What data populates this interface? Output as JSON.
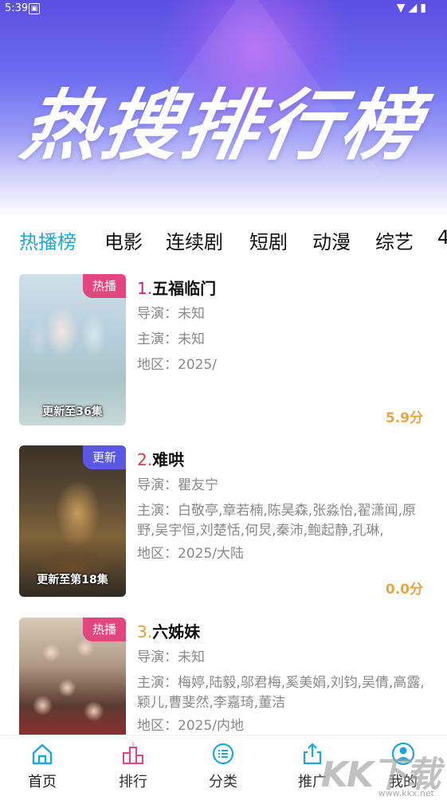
{
  "status": {
    "time": "5:39"
  },
  "hero": {
    "title": "热搜排行榜"
  },
  "tabs": [
    {
      "label": "热播榜",
      "active": true
    },
    {
      "label": "电影"
    },
    {
      "label": "连续剧"
    },
    {
      "label": "短剧"
    },
    {
      "label": "动漫"
    },
    {
      "label": "综艺"
    },
    {
      "label": "4"
    }
  ],
  "items": [
    {
      "rank": "1.",
      "title": "五福临门",
      "badge": "热播",
      "update": "更新至36集",
      "director": "导演：未知",
      "cast": "主演：未知",
      "region": "地区：2025/",
      "score": "5.9分"
    },
    {
      "rank": "2.",
      "title": "难哄",
      "badge": "更新",
      "update": "更新至第18集",
      "director": "导演：瞿友宁",
      "cast": "主演：白敬亭,章若楠,陈昊森,张淼怡,翟潇闻,原野,吴宇恒,刘楚恬,何炅,秦沛,鲍起静,孔琳,",
      "region": "地区：2025/大陆",
      "score": "0.0分"
    },
    {
      "rank": "3.",
      "title": "六姊妹",
      "badge": "热播",
      "update": "",
      "director": "导演：未知",
      "cast": "主演：梅婷,陆毅,邬君梅,奚美娟,刘钧,吴倩,高露,颖儿,曹斐然,李嘉琦,董洁",
      "region": "地区：2025/内地",
      "score": ""
    }
  ],
  "nav": [
    {
      "label": "首页",
      "icon": "home-icon",
      "active": true
    },
    {
      "label": "排行",
      "icon": "ranking-icon"
    },
    {
      "label": "分类",
      "icon": "category-icon"
    },
    {
      "label": "推广",
      "icon": "share-icon"
    },
    {
      "label": "我的",
      "icon": "user-icon"
    }
  ],
  "watermark": {
    "brand": "KK下载",
    "url": "www.kkx.net"
  },
  "colors": {
    "accent": "#1ea7d8",
    "hot_badge": "#e2467c",
    "new_badge": "#5b57e6",
    "score": "#eba540"
  }
}
